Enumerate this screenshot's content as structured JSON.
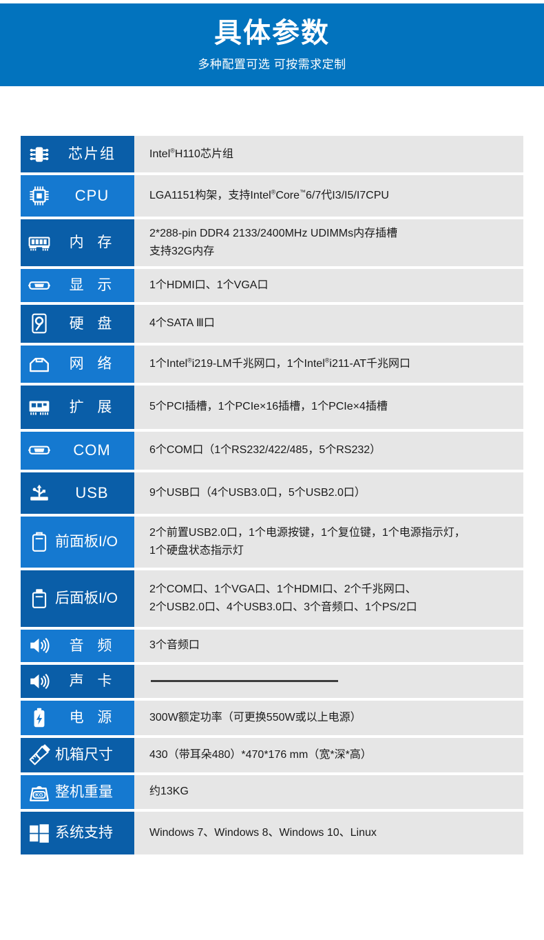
{
  "banner": {
    "title": "具体参数",
    "subtitle": "多种配置可选 可按需求定制",
    "background_color": "#0273be"
  },
  "colors": {
    "banner_blue": "#0273be",
    "label_dark_blue": "#0a5ea8",
    "label_light_blue": "#1579d0",
    "value_gray": "#e6e6e6",
    "value_text": "#1a1a1a",
    "rule_dark": "#3c3c3c"
  },
  "table": {
    "rows": [
      {
        "icon": "chip-icon",
        "label": "芯片组",
        "label_style": "sp3",
        "shade": "dark",
        "lines": [
          "Intel®H110芯片组"
        ]
      },
      {
        "icon": "cpu-icon",
        "label": "CPU",
        "label_style": "lat",
        "shade": "light",
        "lines": [
          "LGA1151构架，支持Intel®Core™6/7代I3/I5/I7CPU"
        ]
      },
      {
        "icon": "memory-icon",
        "label": "内 存",
        "label_style": "sp",
        "shade": "dark",
        "lines": [
          "2*288-pin DDR4 2133/2400MHz UDIMMs内存插槽",
          "支持32G内存"
        ]
      },
      {
        "icon": "vga-display-icon",
        "label": "显 示",
        "label_style": "sp",
        "shade": "light",
        "lines": [
          "1个HDMI口、1个VGA口"
        ]
      },
      {
        "icon": "harddisk-icon",
        "label": "硬 盘",
        "label_style": "sp",
        "shade": "dark",
        "lines": [
          " 4个SATA Ⅲ口"
        ]
      },
      {
        "icon": "network-port-icon",
        "label": "网 络",
        "label_style": "sp",
        "shade": "light",
        "lines": [
          "1个Intel®i219-LM千兆网口，1个Intel®i211-AT千兆网口"
        ]
      },
      {
        "icon": "expansion-card-icon",
        "label": "扩 展",
        "label_style": "sp",
        "shade": "dark",
        "lines": [
          "5个PCI插槽，1个PCIe×16插槽，1个PCIe×4插槽"
        ]
      },
      {
        "icon": "com-port-icon",
        "label": "COM",
        "label_style": "lat",
        "shade": "light",
        "lines": [
          "6个COM口（1个RS232/422/485，5个RS232）"
        ]
      },
      {
        "icon": "usb-icon",
        "label": "USB",
        "label_style": "lat",
        "shade": "dark",
        "lines": [
          "9个USB口（4个USB3.0口，5个USB2.0口）"
        ]
      },
      {
        "icon": "front-panel-icon",
        "label": "前面板I/O",
        "label_style": "tight",
        "shade": "light",
        "lines": [
          "2个前置USB2.0口，1个电源按键，1个复位键，1个电源指示灯，",
          "1个硬盘状态指示灯"
        ]
      },
      {
        "icon": "rear-panel-icon",
        "label": "后面板I/O",
        "label_style": "tight",
        "shade": "dark",
        "lines": [
          "2个COM口、1个VGA口、1个HDMI口、2个千兆网口、",
          "2个USB2.0口、4个USB3.0口、3个音频口、1个PS/2口"
        ]
      },
      {
        "icon": "speaker-icon",
        "label": "音 频",
        "label_style": "sp",
        "shade": "light",
        "lines": [
          "3个音频口"
        ]
      },
      {
        "icon": "speaker-icon",
        "label": "声 卡",
        "label_style": "sp",
        "shade": "dark",
        "lines": [],
        "rule": true
      },
      {
        "icon": "battery-icon",
        "label": "电 源",
        "label_style": "sp",
        "shade": "light",
        "lines": [
          "300W额定功率（可更换550W或以上电源）"
        ]
      },
      {
        "icon": "ruler-pencil-icon",
        "label": "机箱尺寸",
        "label_style": "tight",
        "shade": "dark",
        "lines": [
          "430（带耳朵480）*470*176 mm（宽*深*高）"
        ]
      },
      {
        "icon": "weight-icon",
        "label": "整机重量",
        "label_style": "tight",
        "shade": "light",
        "lines": [
          "约13KG"
        ]
      },
      {
        "icon": "windows-icon",
        "label": "系统支持",
        "label_style": "tight",
        "shade": "dark",
        "lines": [
          "Windows 7、Windows 8、Windows 10、Linux"
        ]
      }
    ]
  }
}
